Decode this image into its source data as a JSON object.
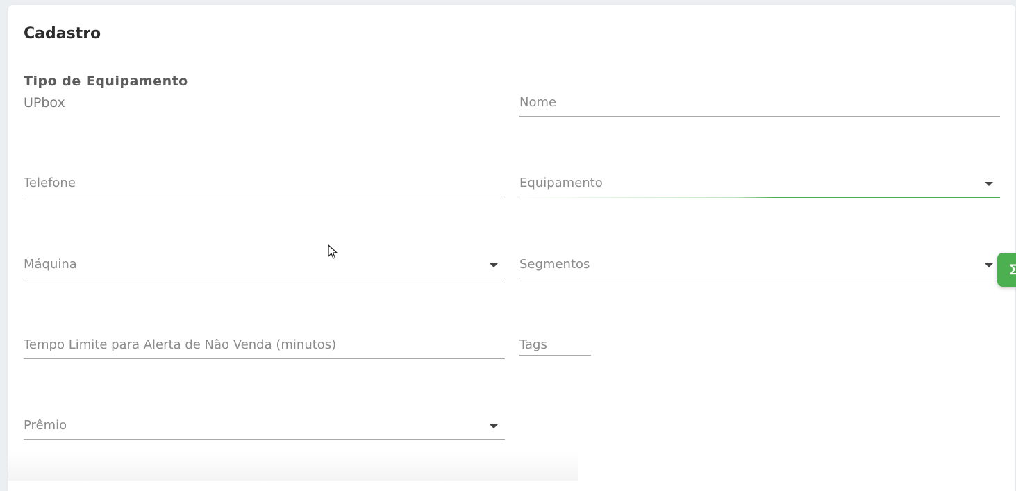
{
  "card": {
    "title": "Cadastro"
  },
  "tipo_equipamento": {
    "label": "Tipo de Equipamento",
    "value": "UPbox"
  },
  "fields": {
    "nome": {
      "label": "Nome"
    },
    "telefone": {
      "label": "Telefone"
    },
    "equipamento": {
      "label": "Equipamento",
      "focused": true
    },
    "maquina": {
      "label": "Máquina"
    },
    "segmentos": {
      "label": "Segmentos"
    },
    "tempo_limite": {
      "label": "Tempo Limite para Alerta de Não Venda (minutos)"
    },
    "tags": {
      "label": "Tags"
    },
    "premio": {
      "label": "Prêmio"
    }
  },
  "colors": {
    "accent": "#4caf50",
    "text_muted": "#8b8b8b",
    "title": "#2d2d2d"
  },
  "icons": {
    "dropdown": "chevron-down-icon",
    "side_tab": "side-tab-icon",
    "cursor": "mouse-pointer-icon"
  }
}
